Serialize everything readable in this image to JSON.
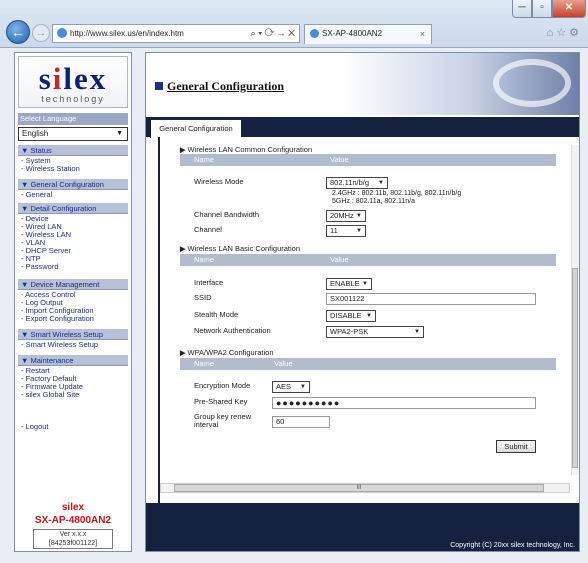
{
  "browser": {
    "url": "http://www.silex.us/en/index.htm",
    "url_tools": "⌕ ▾ ⟳ → ✕",
    "tab_title": "SX-AP-4800AN2",
    "tab_close": "×",
    "window_controls": {
      "minimize": "─",
      "maximize": "▫",
      "close": "✕"
    },
    "toolbar_icons": [
      "home-icon",
      "star-icon",
      "gear-icon"
    ]
  },
  "sidebar": {
    "logo_text_a": "s",
    "logo_text_b": "i",
    "logo_text_c": "lex",
    "logo_tagline": "technology",
    "language_label": "Select Language",
    "language_value": "English",
    "sections": [
      {
        "title": "▼ Status",
        "items": [
          "- System",
          "- Wireless Station"
        ]
      },
      {
        "title": "▼ General Configuration",
        "items": [
          "- General"
        ]
      },
      {
        "title": "▼ Detail Configuration",
        "items": [
          "- Device",
          "- Wired LAN",
          "- Wireless LAN",
          "- VLAN",
          "- DHCP Server",
          "- NTP",
          "- Password"
        ]
      },
      {
        "title": "▼ Device Management",
        "items": [
          "- Access Control",
          "- Log Output",
          "- Import Configuration",
          "- Export Configuration"
        ]
      },
      {
        "title": "▼ Smart Wireless Setup",
        "items": [
          "- Smart Wireless Setup"
        ]
      },
      {
        "title": "▼ Maintenance",
        "items": [
          "- Restart",
          "- Factory Default",
          "- Firmware Update",
          "- silex Global Site"
        ]
      }
    ],
    "logout": "- Logout",
    "brand": "silex",
    "product": "SX-AP-4800AN2",
    "version_line1": "Ver x.x.x",
    "version_line2": "[84253f001122]"
  },
  "main": {
    "header_title": "General Configuration",
    "active_tab": "General Configuration",
    "sections": {
      "common": {
        "title": "Wireless LAN Common Configuration",
        "col_name": "Name",
        "col_value": "Value",
        "wireless_mode_label": "Wireless Mode",
        "wireless_mode_value": "802.11n/b/g",
        "wireless_mode_note1": "2.4GHz : 802.11b, 802.11b/g, 802.11n/b/g",
        "wireless_mode_note2": "5GHz   : 802.11a, 802.11n/a",
        "bandwidth_label": "Channel Bandwidth",
        "bandwidth_value": "20MHz",
        "channel_label": "Channel",
        "channel_value": "11"
      },
      "basic": {
        "title": "Wireless LAN Basic Configuration",
        "col_name": "Name",
        "col_value": "Value",
        "interface_label": "Interface",
        "interface_value": "ENABLE",
        "ssid_label": "SSID",
        "ssid_value": "SX001122",
        "stealth_label": "Stealth Mode",
        "stealth_value": "DISABLE",
        "auth_label": "Network Authentication",
        "auth_value": "WPA2-PSK"
      },
      "wpa": {
        "title": "WPA/WPA2 Configuration",
        "col_name": "Name",
        "col_value": "Value",
        "encryption_label": "Encryption Mode",
        "encryption_value": "AES",
        "psk_label": "Pre-Shared Key",
        "psk_value": "●●●●●●●●●●",
        "renew_label1": "Group key renew",
        "renew_label2": "interval",
        "renew_value": "60"
      }
    },
    "submit_label": "Submit",
    "scroll_label": "III",
    "copyright": "Copyright (C) 20xx silex technology, Inc."
  },
  "colors": {
    "accent": "#14213f",
    "link": "#1b2f85",
    "brand_red": "#cf2222"
  }
}
